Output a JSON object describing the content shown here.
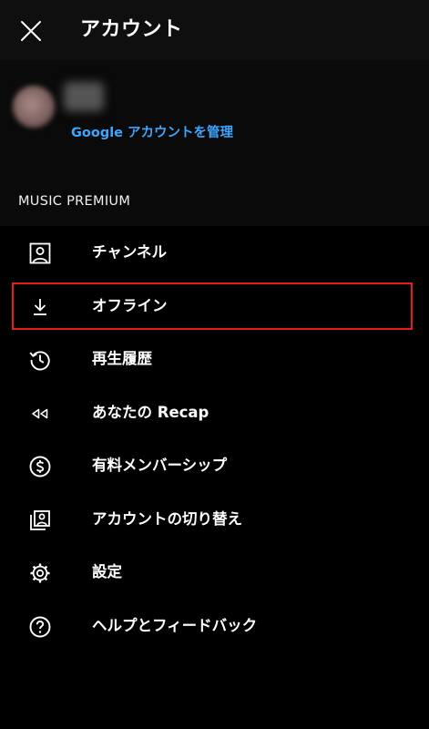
{
  "header": {
    "title": "アカウント",
    "close_icon": "close-icon"
  },
  "profile": {
    "manage_account_link": "Google アカウントを管理",
    "link_color": "#3ea6ff"
  },
  "section_label": "MUSIC PREMIUM",
  "menu": {
    "items": [
      {
        "label": "チャンネル",
        "icon": "channel-icon"
      },
      {
        "label": "オフライン",
        "icon": "download-icon",
        "highlighted": true,
        "highlight_color": "#e41b23"
      },
      {
        "label": "再生履歴",
        "icon": "history-icon"
      },
      {
        "label": "あなたの Recap",
        "icon": "rewind-icon"
      },
      {
        "label": "有料メンバーシップ",
        "icon": "dollar-icon"
      },
      {
        "label": "アカウントの切り替え",
        "icon": "switch-account-icon"
      },
      {
        "label": "設定",
        "icon": "gear-icon"
      },
      {
        "label": "ヘルプとフィードバック",
        "icon": "help-icon"
      }
    ]
  }
}
